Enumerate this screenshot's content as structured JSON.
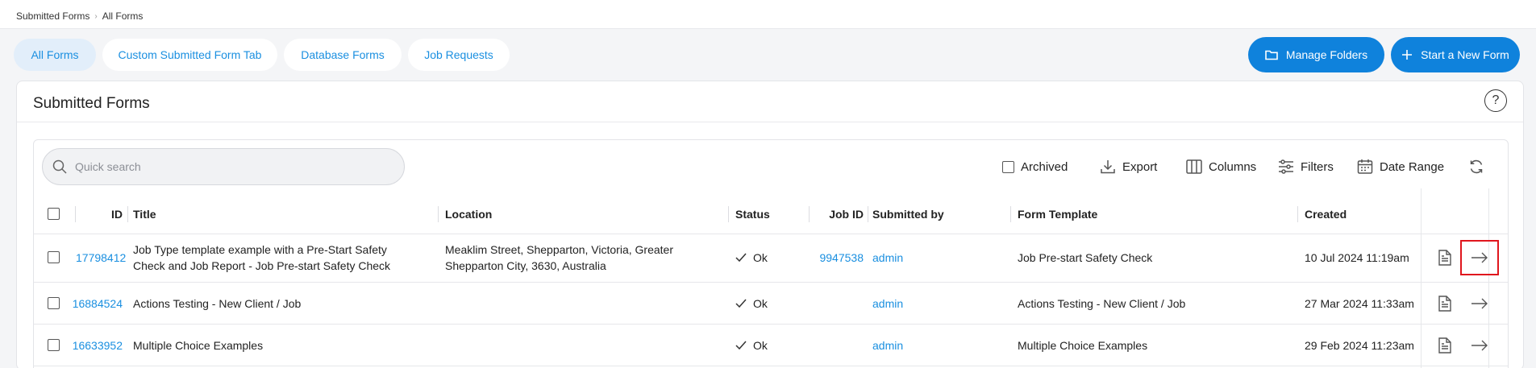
{
  "breadcrumb": [
    "Submitted Forms",
    "All Forms"
  ],
  "tabs": [
    {
      "label": "All Forms",
      "active": true
    },
    {
      "label": "Custom Submitted Form Tab",
      "active": false
    },
    {
      "label": "Database Forms",
      "active": false
    },
    {
      "label": "Job Requests",
      "active": false
    }
  ],
  "buttons": {
    "manage_folders": "Manage Folders",
    "start_new_form": "Start a New Form"
  },
  "card_title": "Submitted Forms",
  "help_label": "?",
  "search": {
    "placeholder": "Quick search"
  },
  "toolbar": {
    "archived": "Archived",
    "export": "Export",
    "columns": "Columns",
    "filters": "Filters",
    "date_range": "Date Range"
  },
  "columns": [
    "ID",
    "Title",
    "Location",
    "Status",
    "Job ID",
    "Submitted by",
    "Form Template",
    "Created"
  ],
  "rows": [
    {
      "id": "17798412",
      "title_line1": "Job Type template example with a Pre-Start Safety",
      "title_line2": "Check and Job Report - Job Pre-start Safety Check",
      "location_line1": "Meaklim Street, Shepparton, Victoria, Greater",
      "location_line2": "Shepparton City, 3630, Australia",
      "status": "Ok",
      "job_id": "9947538",
      "submitted_by": "admin",
      "form_template": "Job Pre-start Safety Check",
      "created": "10 Jul 2024 11:19am"
    },
    {
      "id": "16884524",
      "title": "Actions Testing - New Client / Job",
      "status": "Ok",
      "submitted_by": "admin",
      "form_template": "Actions Testing - New Client / Job",
      "created": "27 Mar 2024 11:33am"
    },
    {
      "id": "16633952",
      "title": "Multiple Choice Examples",
      "status": "Ok",
      "submitted_by": "admin",
      "form_template": "Multiple Choice Examples",
      "created": "29 Feb 2024 11:23am"
    }
  ],
  "colors": {
    "accent": "#1a8fe0",
    "primary_button": "#0f82dc",
    "active_tab_bg": "#e2eefa",
    "highlight": "#e0161d"
  }
}
